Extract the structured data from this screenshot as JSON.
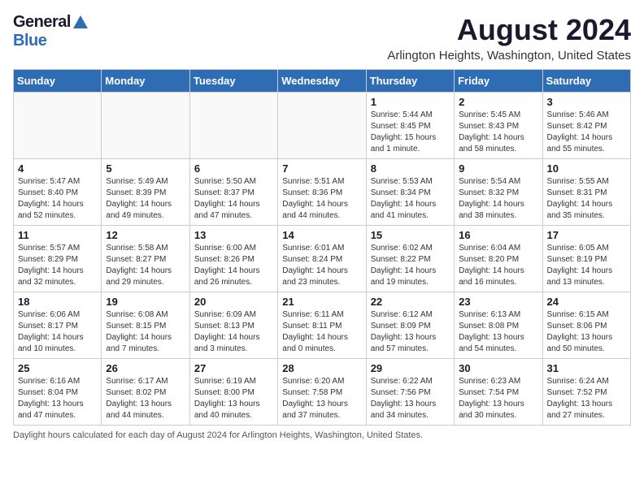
{
  "header": {
    "logo_general": "General",
    "logo_blue": "Blue",
    "month_title": "August 2024",
    "location": "Arlington Heights, Washington, United States"
  },
  "days_of_week": [
    "Sunday",
    "Monday",
    "Tuesday",
    "Wednesday",
    "Thursday",
    "Friday",
    "Saturday"
  ],
  "footer": {
    "daylight_note": "Daylight hours"
  },
  "weeks": [
    [
      {
        "day": "",
        "info": ""
      },
      {
        "day": "",
        "info": ""
      },
      {
        "day": "",
        "info": ""
      },
      {
        "day": "",
        "info": ""
      },
      {
        "day": "1",
        "info": "Sunrise: 5:44 AM\nSunset: 8:45 PM\nDaylight: 15 hours\nand 1 minute."
      },
      {
        "day": "2",
        "info": "Sunrise: 5:45 AM\nSunset: 8:43 PM\nDaylight: 14 hours\nand 58 minutes."
      },
      {
        "day": "3",
        "info": "Sunrise: 5:46 AM\nSunset: 8:42 PM\nDaylight: 14 hours\nand 55 minutes."
      }
    ],
    [
      {
        "day": "4",
        "info": "Sunrise: 5:47 AM\nSunset: 8:40 PM\nDaylight: 14 hours\nand 52 minutes."
      },
      {
        "day": "5",
        "info": "Sunrise: 5:49 AM\nSunset: 8:39 PM\nDaylight: 14 hours\nand 49 minutes."
      },
      {
        "day": "6",
        "info": "Sunrise: 5:50 AM\nSunset: 8:37 PM\nDaylight: 14 hours\nand 47 minutes."
      },
      {
        "day": "7",
        "info": "Sunrise: 5:51 AM\nSunset: 8:36 PM\nDaylight: 14 hours\nand 44 minutes."
      },
      {
        "day": "8",
        "info": "Sunrise: 5:53 AM\nSunset: 8:34 PM\nDaylight: 14 hours\nand 41 minutes."
      },
      {
        "day": "9",
        "info": "Sunrise: 5:54 AM\nSunset: 8:32 PM\nDaylight: 14 hours\nand 38 minutes."
      },
      {
        "day": "10",
        "info": "Sunrise: 5:55 AM\nSunset: 8:31 PM\nDaylight: 14 hours\nand 35 minutes."
      }
    ],
    [
      {
        "day": "11",
        "info": "Sunrise: 5:57 AM\nSunset: 8:29 PM\nDaylight: 14 hours\nand 32 minutes."
      },
      {
        "day": "12",
        "info": "Sunrise: 5:58 AM\nSunset: 8:27 PM\nDaylight: 14 hours\nand 29 minutes."
      },
      {
        "day": "13",
        "info": "Sunrise: 6:00 AM\nSunset: 8:26 PM\nDaylight: 14 hours\nand 26 minutes."
      },
      {
        "day": "14",
        "info": "Sunrise: 6:01 AM\nSunset: 8:24 PM\nDaylight: 14 hours\nand 23 minutes."
      },
      {
        "day": "15",
        "info": "Sunrise: 6:02 AM\nSunset: 8:22 PM\nDaylight: 14 hours\nand 19 minutes."
      },
      {
        "day": "16",
        "info": "Sunrise: 6:04 AM\nSunset: 8:20 PM\nDaylight: 14 hours\nand 16 minutes."
      },
      {
        "day": "17",
        "info": "Sunrise: 6:05 AM\nSunset: 8:19 PM\nDaylight: 14 hours\nand 13 minutes."
      }
    ],
    [
      {
        "day": "18",
        "info": "Sunrise: 6:06 AM\nSunset: 8:17 PM\nDaylight: 14 hours\nand 10 minutes."
      },
      {
        "day": "19",
        "info": "Sunrise: 6:08 AM\nSunset: 8:15 PM\nDaylight: 14 hours\nand 7 minutes."
      },
      {
        "day": "20",
        "info": "Sunrise: 6:09 AM\nSunset: 8:13 PM\nDaylight: 14 hours\nand 3 minutes."
      },
      {
        "day": "21",
        "info": "Sunrise: 6:11 AM\nSunset: 8:11 PM\nDaylight: 14 hours\nand 0 minutes."
      },
      {
        "day": "22",
        "info": "Sunrise: 6:12 AM\nSunset: 8:09 PM\nDaylight: 13 hours\nand 57 minutes."
      },
      {
        "day": "23",
        "info": "Sunrise: 6:13 AM\nSunset: 8:08 PM\nDaylight: 13 hours\nand 54 minutes."
      },
      {
        "day": "24",
        "info": "Sunrise: 6:15 AM\nSunset: 8:06 PM\nDaylight: 13 hours\nand 50 minutes."
      }
    ],
    [
      {
        "day": "25",
        "info": "Sunrise: 6:16 AM\nSunset: 8:04 PM\nDaylight: 13 hours\nand 47 minutes."
      },
      {
        "day": "26",
        "info": "Sunrise: 6:17 AM\nSunset: 8:02 PM\nDaylight: 13 hours\nand 44 minutes."
      },
      {
        "day": "27",
        "info": "Sunrise: 6:19 AM\nSunset: 8:00 PM\nDaylight: 13 hours\nand 40 minutes."
      },
      {
        "day": "28",
        "info": "Sunrise: 6:20 AM\nSunset: 7:58 PM\nDaylight: 13 hours\nand 37 minutes."
      },
      {
        "day": "29",
        "info": "Sunrise: 6:22 AM\nSunset: 7:56 PM\nDaylight: 13 hours\nand 34 minutes."
      },
      {
        "day": "30",
        "info": "Sunrise: 6:23 AM\nSunset: 7:54 PM\nDaylight: 13 hours\nand 30 minutes."
      },
      {
        "day": "31",
        "info": "Sunrise: 6:24 AM\nSunset: 7:52 PM\nDaylight: 13 hours\nand 27 minutes."
      }
    ]
  ]
}
